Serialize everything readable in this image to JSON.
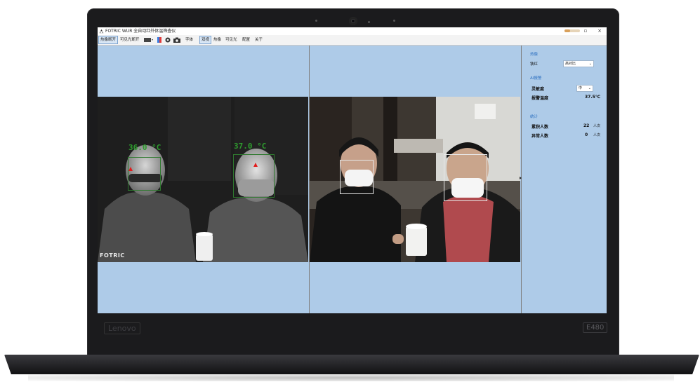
{
  "window": {
    "title": "FOTRIC WUR 全自动红外体温筛查仪",
    "close_symbol": "×",
    "restore_symbol": "▫"
  },
  "toolbar": {
    "items": [
      {
        "label": "热像断开",
        "selected": true
      },
      {
        "label": "可见光断开",
        "selected": false
      },
      {
        "label": "字体",
        "selected": false
      },
      {
        "label": "双视",
        "selected": true
      },
      {
        "label": "热像",
        "selected": false
      },
      {
        "label": "可见光",
        "selected": false
      },
      {
        "label": "配置",
        "selected": false
      },
      {
        "label": "关于",
        "selected": false
      }
    ]
  },
  "thermal": {
    "temps": [
      "36.0 °C",
      "37.0 °C"
    ],
    "watermark": "FOTRIC"
  },
  "side_panel": {
    "thermal_section": "热像",
    "palette_label": "铁红",
    "palette_value": "高对比",
    "ai_section": "AI报警",
    "sensitivity_label": "灵敏度",
    "sensitivity_value": "中",
    "alarm_temp_label": "报警温度",
    "alarm_temp_value": "37.5℃",
    "stats_section": "统计",
    "total_label": "累积人数",
    "total_value": "22",
    "total_unit": "人次",
    "abnormal_label": "异常人数",
    "abnormal_value": "0",
    "abnormal_unit": "人次"
  },
  "hardware": {
    "brand": "Lenovo",
    "model": "E480"
  },
  "colors": {
    "app_background": "#aecbe8",
    "temp_label": "#2e9a2e",
    "alarm_marker": "#e21b1b",
    "section_heading": "#2b6fc0"
  }
}
